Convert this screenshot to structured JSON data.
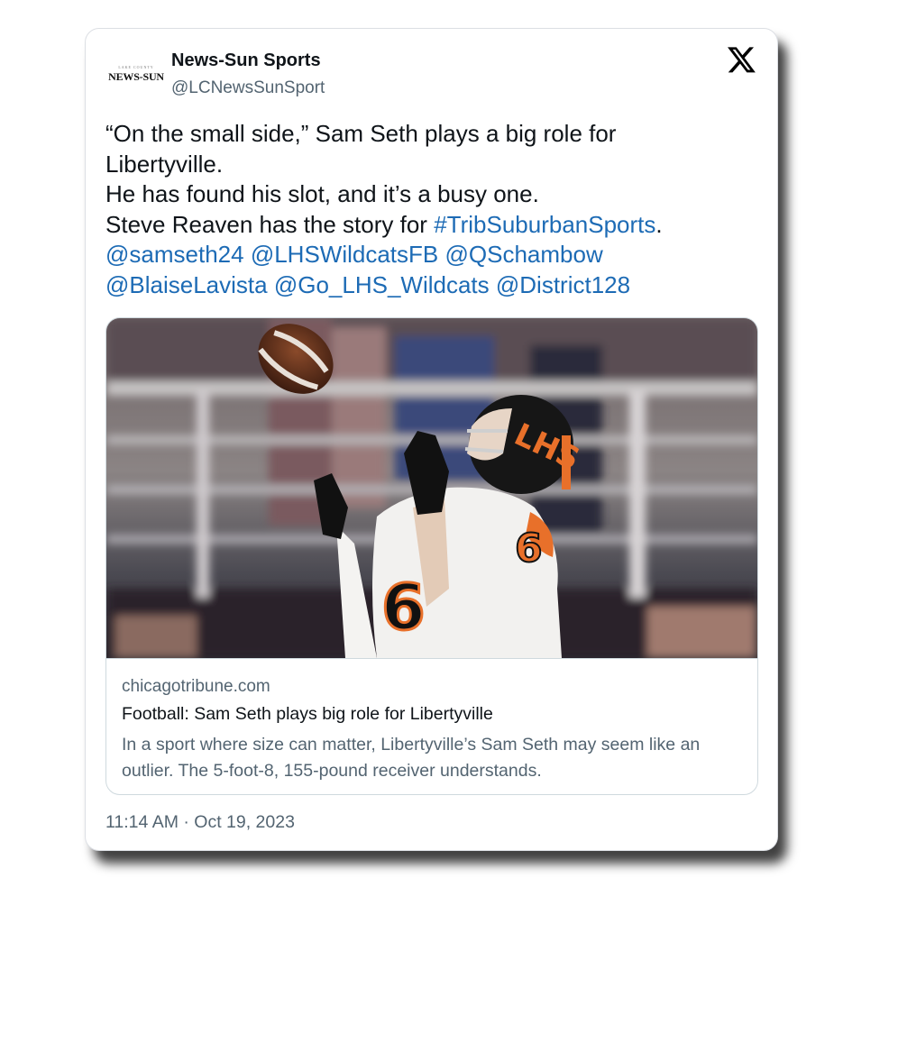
{
  "author": {
    "avatar_small_text": "LAKE COUNTY",
    "avatar_text": "NEWS-SUN",
    "display_name": "News-Sun Sports",
    "handle": "@LCNewsSunSport"
  },
  "icons": {
    "close": "x-logo-icon"
  },
  "tweet": {
    "line1": "“On the small side,” Sam Seth plays a big role for",
    "line2": "Libertyville.",
    "line3": "He has found his slot, and it’s a busy one.",
    "line4_prefix": "Steve Reaven has the story for ",
    "hashtag": "#TribSuburbanSports",
    "line4_suffix": ".",
    "mentions_row1": [
      "@samseth24",
      "@LHSWildcatsFB",
      "@QSchambow"
    ],
    "mentions_row2": [
      "@BlaiseLavista",
      "@Go_LHS_Wildcats",
      "@District128"
    ]
  },
  "link_card": {
    "jersey_number": "6",
    "helmet_text": "LHS",
    "domain": "chicagotribune.com",
    "title": "Football: Sam Seth plays big role for Libertyville",
    "description": "In a sport where size can matter, Libertyville’s Sam Seth may seem like an outlier. The 5-foot-8, 155-pound receiver understands."
  },
  "timestamp": "11:14 AM · Oct 19, 2023",
  "colors": {
    "link": "#1d6bb5",
    "text": "#0f1419",
    "secondary": "#536471",
    "jersey_orange": "#e8702a"
  }
}
